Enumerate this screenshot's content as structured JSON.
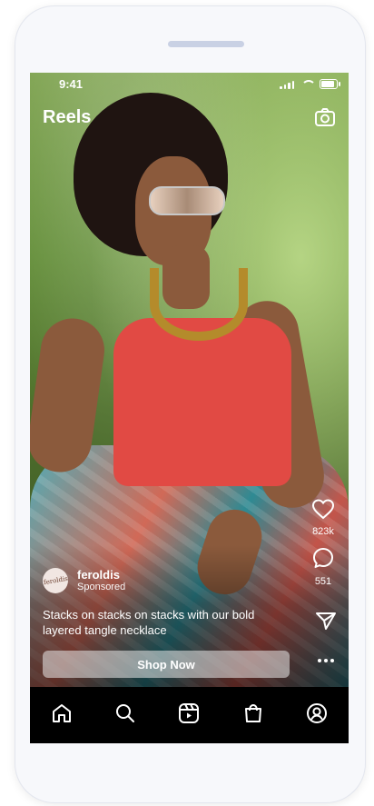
{
  "status": {
    "time": "9:41"
  },
  "header": {
    "title": "Reels",
    "camera_icon": "camera-icon"
  },
  "actions": {
    "likes": "823k",
    "comments": "551"
  },
  "post": {
    "username": "feroldis",
    "sponsored": "Sponsored",
    "avatar_text": "feroldis",
    "caption": "Stacks on stacks on stacks with our bold layered tangle necklace",
    "cta": "Shop Now"
  },
  "tabs": [
    "home-icon",
    "search-icon",
    "reels-icon",
    "shop-icon",
    "profile-icon"
  ]
}
